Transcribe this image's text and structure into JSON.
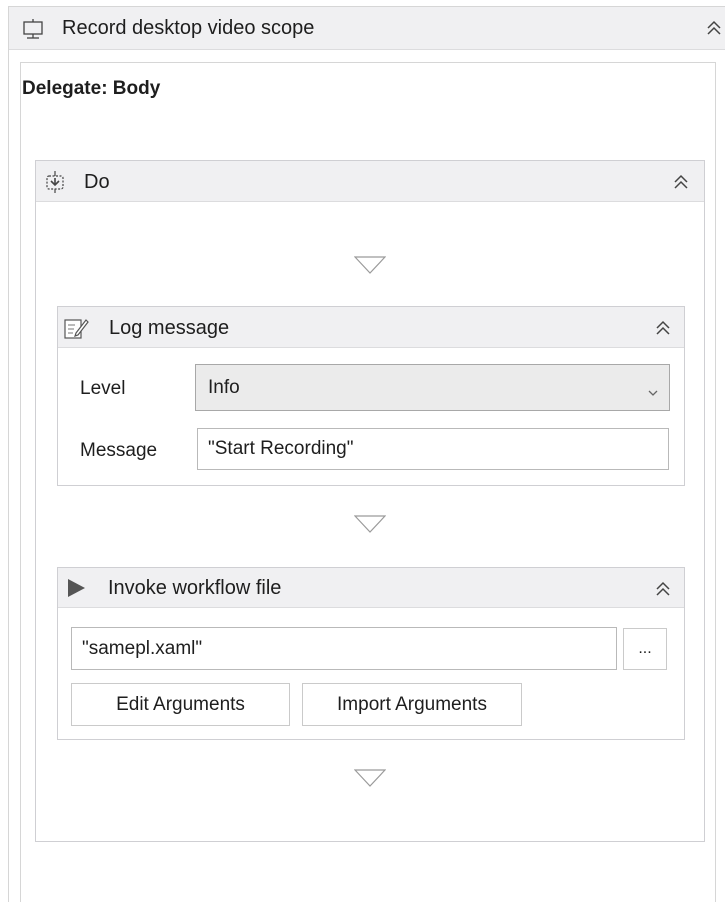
{
  "scope": {
    "title": "Record desktop video scope",
    "icon": "monitor-icon",
    "collapse_icon": "double-chevron-up-icon",
    "delegate_label": "Delegate: Body"
  },
  "do_block": {
    "title": "Do",
    "icon": "sequence-icon",
    "collapse_icon": "double-chevron-up-icon"
  },
  "log_message": {
    "title": "Log message",
    "icon": "pencil-note-icon",
    "level_label": "Level",
    "level_value": "Info",
    "message_label": "Message",
    "message_value": "\"Start Recording\""
  },
  "invoke_workflow": {
    "title": "Invoke workflow file",
    "icon": "play-icon",
    "file_value": "\"samepl.xaml\"",
    "browse_label": "...",
    "edit_arguments_label": "Edit Arguments",
    "import_arguments_label": "Import Arguments"
  },
  "colors": {
    "header_bg": "#f0f0f2",
    "border": "#cfcfd3",
    "dropdown_bg": "#ebebeb"
  }
}
